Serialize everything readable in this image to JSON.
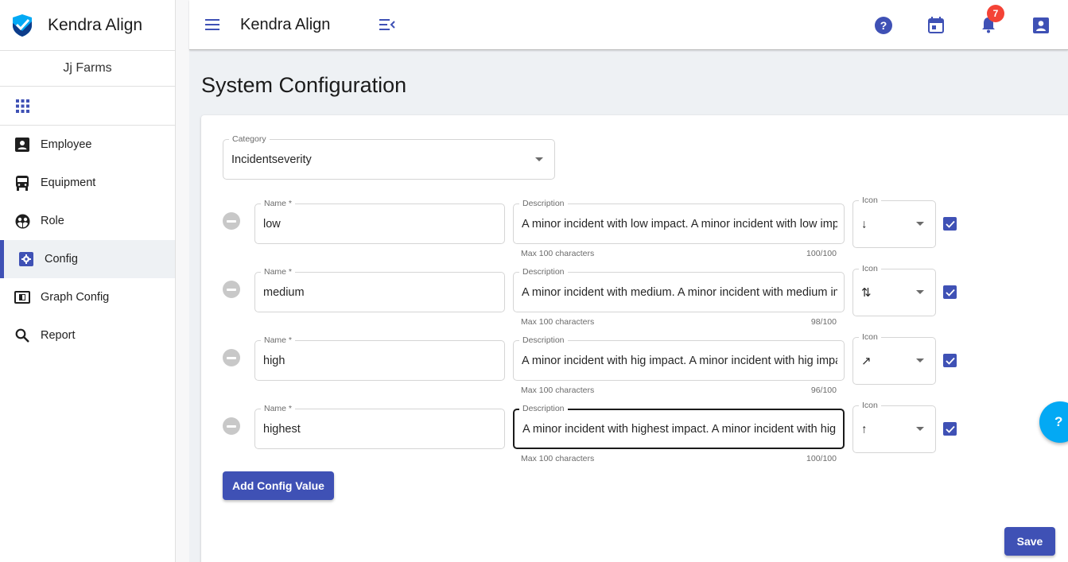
{
  "app": {
    "brand_name": "Kendra Align",
    "organization": "Jj Farms"
  },
  "colors": {
    "primary": "#3f51b5",
    "badge": "#f44336",
    "help_fab": "#03a9f4",
    "logo_light": "#03a9f4",
    "logo_dark": "#0d3c8a"
  },
  "sidebar": {
    "apps_icon": "apps-grid-icon",
    "items": [
      {
        "label": "Employee",
        "icon": "account-box-icon",
        "active": false
      },
      {
        "label": "Equipment",
        "icon": "bus-icon",
        "active": false
      },
      {
        "label": "Role",
        "icon": "face-group-icon",
        "active": false
      },
      {
        "label": "Config",
        "icon": "settings-box-icon",
        "active": true
      },
      {
        "label": "Graph Config",
        "icon": "graph-config-icon",
        "active": false
      },
      {
        "label": "Report",
        "icon": "search-icon",
        "active": false
      }
    ]
  },
  "topbar": {
    "title": "Kendra Align",
    "menu_icon": "hamburger-menu-icon",
    "collapse_icon": "menu-open-icon",
    "actions": [
      {
        "name": "help",
        "icon": "help-circle-icon"
      },
      {
        "name": "calendar",
        "icon": "calendar-icon"
      },
      {
        "name": "notifications",
        "icon": "bell-icon",
        "badge": "7"
      },
      {
        "name": "profile",
        "icon": "account-box-icon"
      }
    ]
  },
  "page": {
    "title": "System Configuration"
  },
  "form": {
    "category": {
      "label": "Category",
      "value": "Incidentseverity"
    },
    "name_label": "Name *",
    "description_label": "Description",
    "icon_label": "Icon",
    "helper_text": "Max 100 characters",
    "rows": [
      {
        "name": "low",
        "description": "A minor incident with low impact.  A minor incident with low impact. A minor incident with low impact.",
        "description_visible": "A minor incident with low impact.  A minor incident with low imp",
        "counter": "100/100",
        "icon": "arrow-down-icon",
        "icon_glyph": "↓",
        "checked": true,
        "focused": false
      },
      {
        "name": "medium",
        "description_visible": "A minor incident with medium. A minor incident with medium im",
        "counter": "98/100",
        "icon": "swap-vertical-icon",
        "icon_glyph": "⇅",
        "checked": true,
        "focused": false
      },
      {
        "name": "high",
        "description_visible": "A minor incident with hig impact. A minor incident with hig impa",
        "counter": "96/100",
        "icon": "trending-up-icon",
        "icon_glyph": "↗",
        "checked": true,
        "focused": false
      },
      {
        "name": "highest",
        "description_visible": "A minor incident with highest impact. A minor incident with high",
        "counter": "100/100",
        "icon": "arrow-up-icon",
        "icon_glyph": "↑",
        "checked": true,
        "focused": true
      }
    ],
    "add_button": "Add Config Value",
    "save_button": "Save"
  },
  "help_fab": {
    "label": "?"
  }
}
